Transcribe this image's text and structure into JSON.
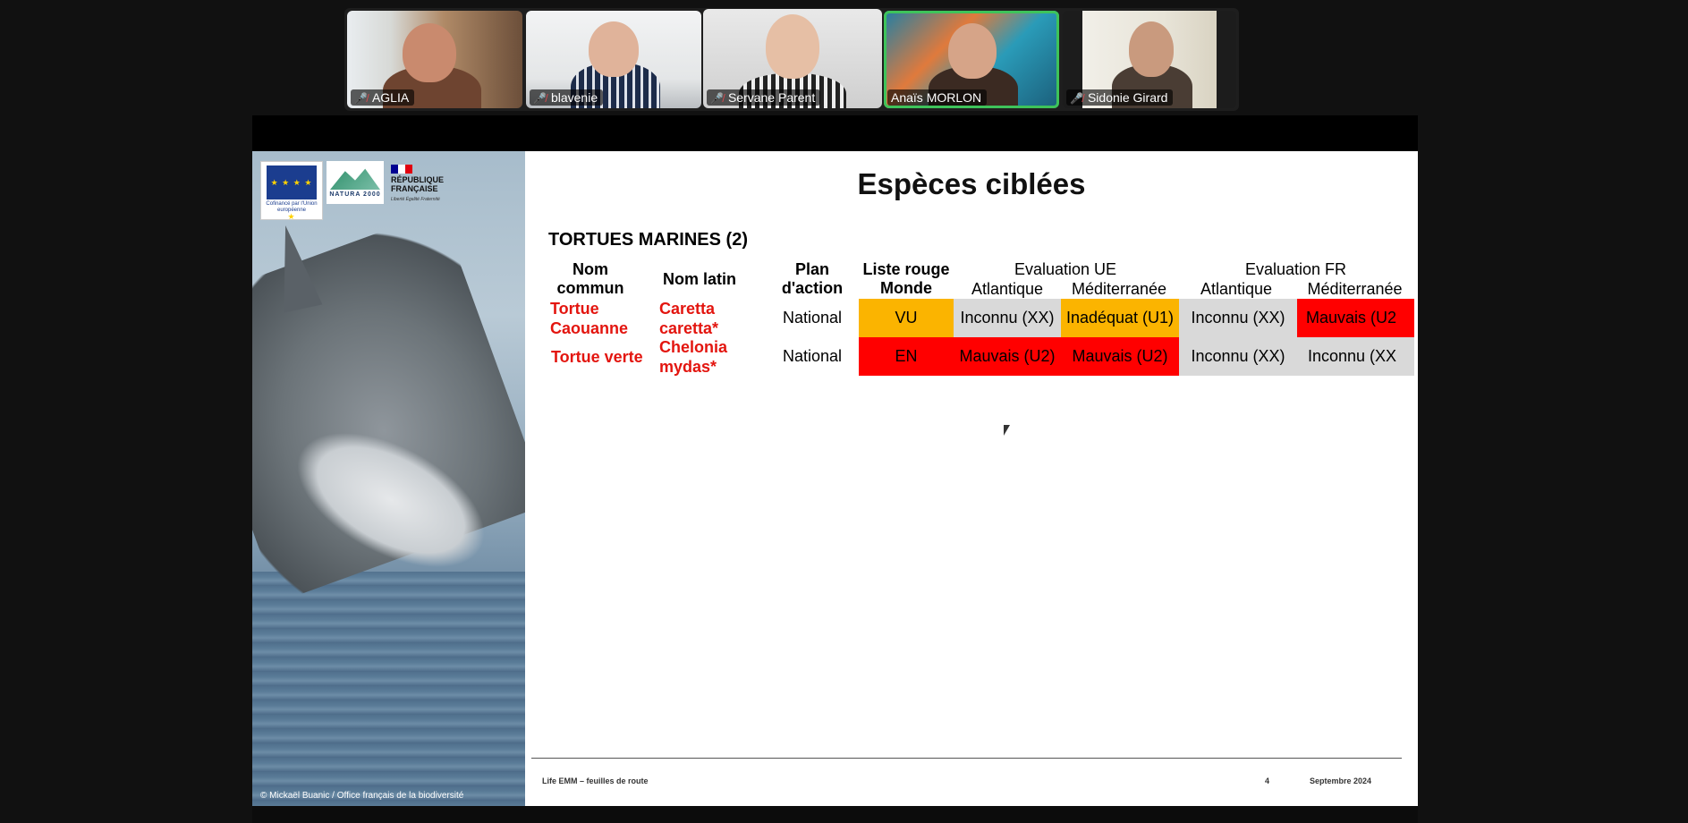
{
  "participants": [
    {
      "name": "AGLIA",
      "muted": true
    },
    {
      "name": "blavenie",
      "muted": true
    },
    {
      "name": "Servane Parent",
      "muted": true
    },
    {
      "name": "Anaïs MORLON",
      "muted": false,
      "active": true
    },
    {
      "name": "Sidonie Girard",
      "muted": true
    }
  ],
  "slide": {
    "title": "Espèces ciblées",
    "section": "TORTUES MARINES (2)",
    "logos": {
      "eu_caption": "Cofinancé par l'Union européenne",
      "natura": "NATURA 2000",
      "republique": "RÉPUBLIQUE FRANÇAISE",
      "motto": "Liberté Égalité Fraternité"
    },
    "photo_credit": "© Mickaël Buanic / Office français de la biodiversité",
    "headers": {
      "nom_commun": "Nom commun",
      "nom_latin": "Nom latin",
      "plan_action": "Plan d'action",
      "liste_rouge": "Liste rouge Monde",
      "eval_ue": "Evaluation UE",
      "eval_fr": "Evaluation FR",
      "atlantique": "Atlantique",
      "mediterranee": "Méditerranée"
    },
    "rows": [
      {
        "nom_commun": "Tortue Caouanne",
        "nom_latin": "Caretta caretta*",
        "plan": "National",
        "liste_rouge": "VU",
        "ue_atl": "Inconnu (XX)",
        "ue_med": "Inadéquat (U1)",
        "fr_atl": "Inconnu (XX)",
        "fr_med": "Mauvais (U2"
      },
      {
        "nom_commun": "Tortue verte",
        "nom_latin": "Chelonia mydas*",
        "plan": "National",
        "liste_rouge": "EN",
        "ue_atl": "Mauvais (U2)",
        "ue_med": "Mauvais (U2)",
        "fr_atl": "Inconnu (XX)",
        "fr_med": "Inconnu (XX"
      }
    ],
    "footer": {
      "left": "Life EMM – feuilles de route",
      "page": "4",
      "date": "Septembre 2024"
    }
  },
  "colors": {
    "orange": "#fbb400",
    "red": "#ff0000",
    "grey": "#d9d9d9",
    "latin_red": "#e3150f",
    "active_speaker": "#3ec35a"
  }
}
